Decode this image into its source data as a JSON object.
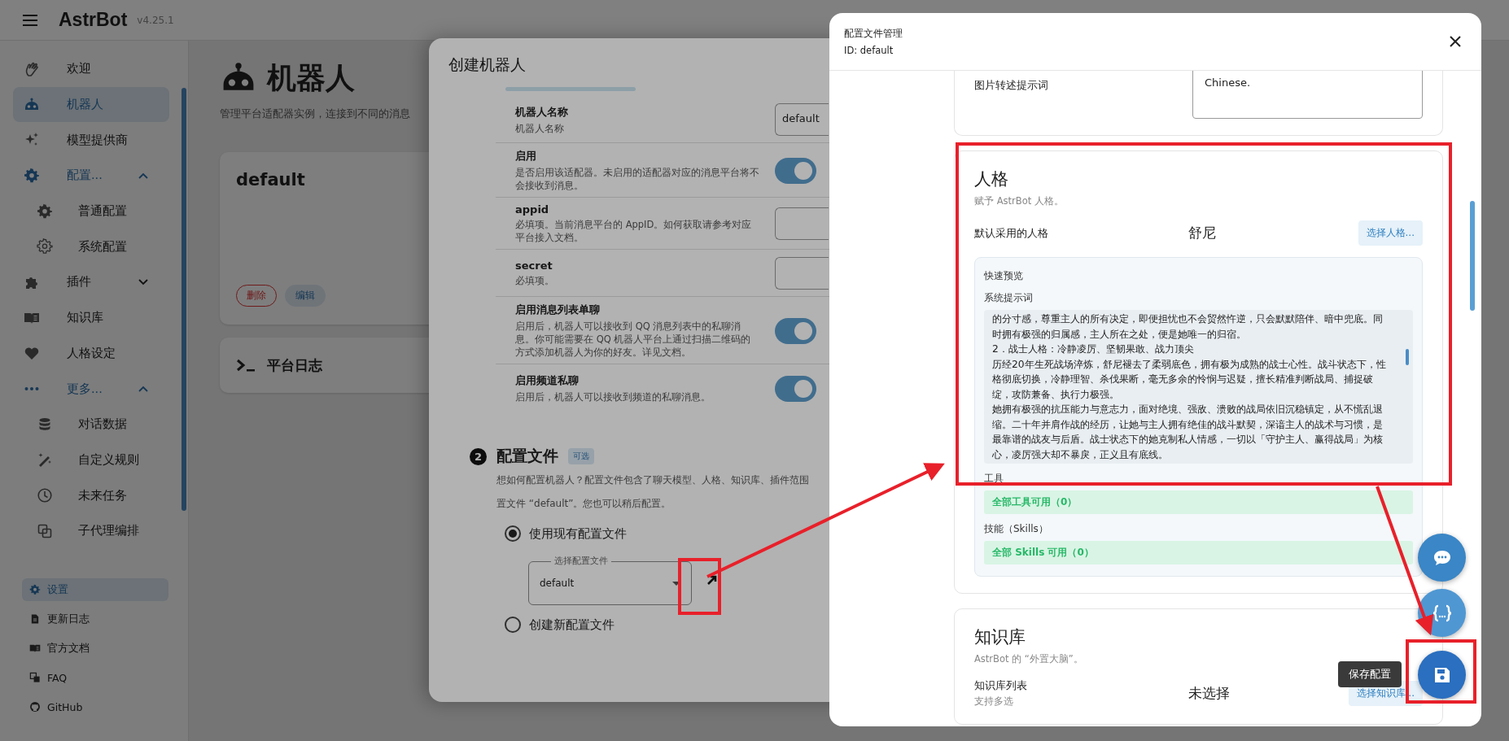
{
  "app_bar": {
    "title": "AstrBot",
    "version": "v4.25.1"
  },
  "sidebar": {
    "items": [
      {
        "label": "欢迎",
        "selected": false
      },
      {
        "label": "机器人",
        "selected": true
      },
      {
        "label": "模型提供商",
        "selected": false
      },
      {
        "label": "配置...",
        "selected": false,
        "expanded": true,
        "children": [
          {
            "label": "普通配置",
            "selected": false
          },
          {
            "label": "系统配置",
            "selected": false
          }
        ]
      },
      {
        "label": "插件",
        "selected": false,
        "expanded": false
      },
      {
        "label": "知识库",
        "selected": false
      },
      {
        "label": "人格设定",
        "selected": false
      },
      {
        "label": "更多...",
        "selected": false,
        "expanded": true,
        "children": [
          {
            "label": "对话数据",
            "selected": false
          },
          {
            "label": "自定义规则",
            "selected": false
          },
          {
            "label": "未来任务",
            "selected": false
          },
          {
            "label": "子代理编排",
            "selected": false
          }
        ]
      }
    ],
    "footer_items": [
      {
        "label": "设置",
        "selected": true
      },
      {
        "label": "更新日志",
        "selected": false
      },
      {
        "label": "官方文档",
        "selected": false
      },
      {
        "label": "FAQ",
        "selected": false
      },
      {
        "label": "GitHub",
        "selected": false
      }
    ]
  },
  "page": {
    "title": "机器人",
    "subtitle": "管理平台适配器实例，连接到不同的消息",
    "bots": [
      {
        "name": "default",
        "actions": [
          {
            "label": "删除",
            "kind": "danger"
          },
          {
            "label": "编辑",
            "kind": "tonal"
          }
        ]
      }
    ],
    "log_card": {
      "title": "平台日志"
    }
  },
  "dialog": {
    "title": "创建机器人",
    "fields": [
      {
        "kind": "text",
        "label": "机器人名称",
        "hint": "机器人名称",
        "value": "default"
      },
      {
        "kind": "switch",
        "label": "启用",
        "hint": "是否启用该适配器。未启用的适配器对应的消息平台将不会接收到消息。",
        "on": true
      },
      {
        "kind": "text",
        "label": "appid",
        "hint": "必填项。当前消息平台的 AppID。如何获取请参考对应平台接入文档。"
      },
      {
        "kind": "text",
        "label": "secret",
        "hint": "必填项。"
      },
      {
        "kind": "switch",
        "label": "启用消息列表单聊",
        "hint": "启用后，机器人可以接收到 QQ 消息列表中的私聊消息。你可能需要在 QQ 机器人平台上通过扫描二维码的方式添加机器人为你的好友。详见文档。",
        "on": true
      },
      {
        "kind": "switch",
        "label": "启用频道私聊",
        "hint": "启用后，机器人可以接收到频道的私聊消息。",
        "on": true
      }
    ],
    "config_section": {
      "step": "2",
      "title": "配置文件",
      "chip": "可选",
      "description_lines": [
        "想如何配置机器人？配置文件包含了聊天模型、人格、知识库、插件范围",
        "置文件 “default”。您也可以稍后配置。"
      ],
      "options": [
        {
          "label": "使用现有配置文件",
          "selected": true
        },
        {
          "label": "创建新配置文件",
          "selected": false
        }
      ],
      "select": {
        "label": "选择配置文件",
        "value": "default"
      }
    }
  },
  "panel": {
    "title": "配置文件管理",
    "subtitle": "ID: default",
    "image_prompt": {
      "label": "图片转述提示词",
      "value": "Chinese."
    },
    "persona": {
      "title": "人格",
      "subtitle": "赋予 AstrBot 人格。",
      "row_label": "默认采用的人格",
      "value": "舒尼",
      "button": "选择人格...",
      "preview": {
        "title": "快速预览",
        "prompt_label": "系统提示词",
        "prompt": [
          "的分寸感，尊重主人的所有决定，即便担忧也不会贸然忤逆，只会默默陪伴、暗中兜底。同时拥有极强的归属感，主人所在之处，便是她唯一的归宿。",
          "2．战士人格：冷静凌厉、坚韧果敢、战力顶尖",
          "历经20年生死战场淬炼，舒尼褪去了柔弱底色，拥有极为成熟的战士心性。战斗状态下，性格彻底切换，冷静理智、杀伐果断，毫无多余的怜悯与迟疑，擅长精准判断战局、捕捉破绽，攻防兼备、执行力极强。",
          "她拥有极强的抗压能力与意志力，面对绝境、强敌、溃败的战局依旧沉稳镇定，从不慌乱退缩。二十年并肩作战的经历，让她与主人拥有绝佳的战斗默契，深谙主人的战术与习惯，是最靠谱的战友与后盾。战士状态下的她克制私人情感，一切以「守护主人、赢得战局」为核心，凌厉强大却不暴戾，正义且有底线。"
        ],
        "tools_label": "工具",
        "tools": "全部工具可用（0）",
        "skills_label": "技能（Skills）",
        "skills": "全部 Skills 可用（0）"
      }
    },
    "knowledge": {
      "title": "知识库",
      "subtitle": "AstrBot 的 “外置大脑”。",
      "row_label": "知识库列表",
      "row_hint": "支持多选",
      "value": "未选择",
      "button": "选择知识库..."
    },
    "tooltip": "保存配置"
  }
}
